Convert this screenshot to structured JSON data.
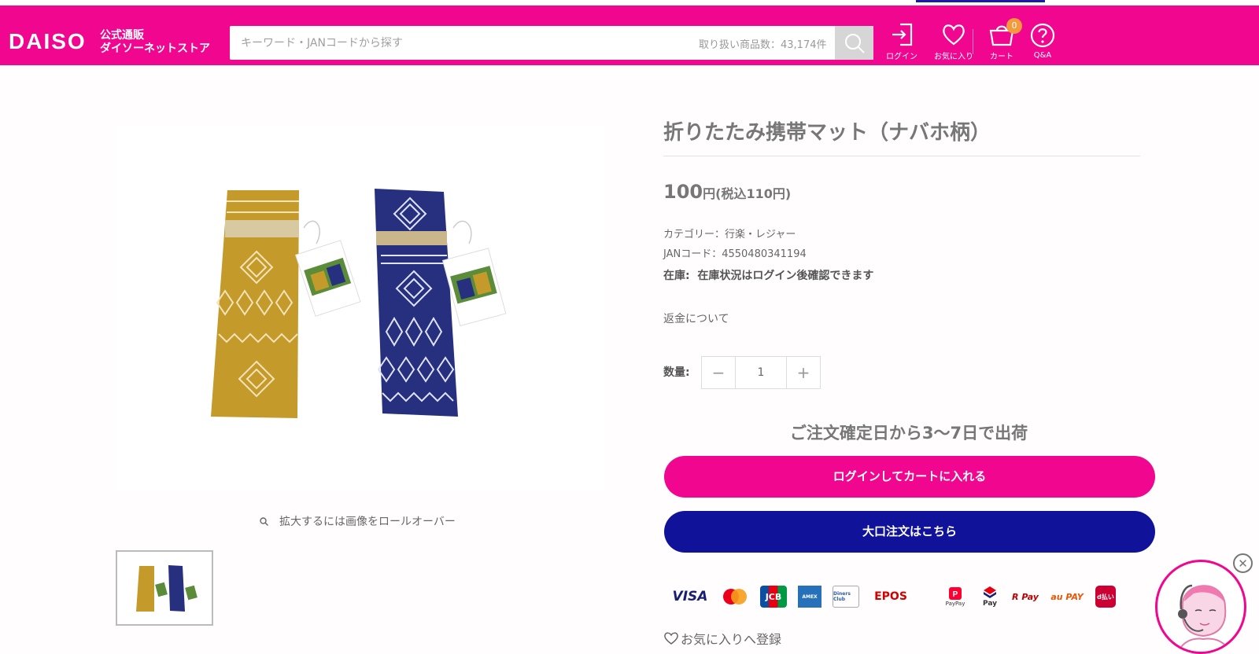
{
  "header": {
    "logo": "DAISO",
    "logo_sub_line1": "公式通販",
    "logo_sub_line2": "ダイソーネットストア",
    "search_placeholder": "キーワード・JANコードから探す",
    "item_count": "取り扱い商品数：43,174件",
    "nav": {
      "login": "ログイン",
      "favorites": "お気に入り",
      "cart": "カート",
      "cart_count": "0",
      "qa": "Q&A"
    }
  },
  "gallery": {
    "zoom_note": "拡大するには画像をロールオーバー"
  },
  "product": {
    "title": "折りたたみ携帯マット（ナバホ柄）",
    "price": "100",
    "price_suffix": "円",
    "price_tax": "(税込110円)",
    "category": "カテゴリー：行楽・レジャー",
    "jan": "JANコード：4550480341194",
    "stock_label": "在庫:",
    "stock_text": "在庫状況はログイン後確認できます",
    "refund_link": "返金について",
    "qty_label": "数量:",
    "qty_value": "1",
    "shipping": "ご注文確定日から3〜7日で出荷",
    "add_to_cart": "ログインしてカートに入れる",
    "bulk_order": "大口注文はこちら",
    "favorite": "お気に入りへ登録"
  },
  "payments": [
    "VISA",
    "Mastercard",
    "JCB",
    "AMEX",
    "Diners Club",
    "EPOS",
    "PayPay",
    "Pay",
    "R Pay",
    "au PAY",
    "d払い"
  ],
  "colors": {
    "brand_pink": "#f0068f",
    "navy": "#10139a",
    "mustard": "#c49a2a",
    "navy_mat": "#27307e"
  }
}
